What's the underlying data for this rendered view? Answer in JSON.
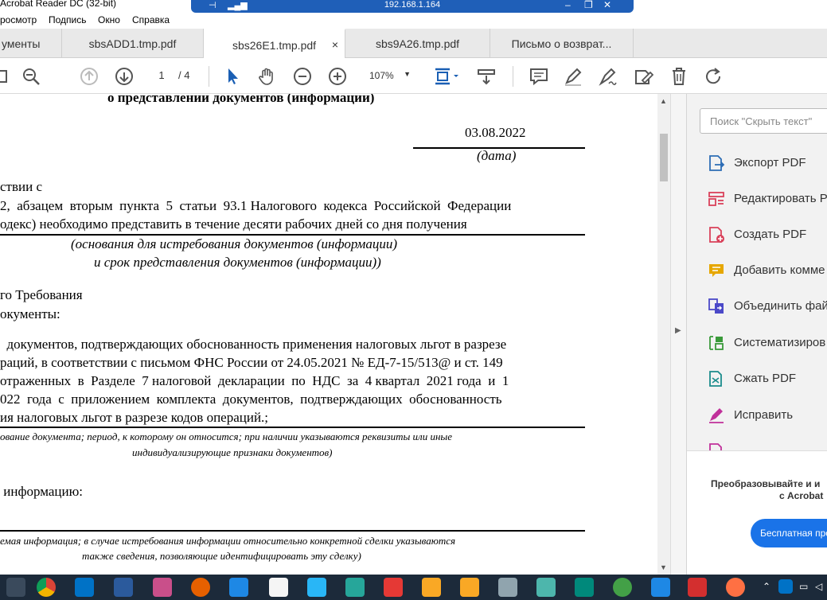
{
  "window": {
    "app_title": "Acrobat Reader DC (32-bit)",
    "rdp_ip": "192.168.1.164"
  },
  "menu": [
    "росмотр",
    "Подпись",
    "Окно",
    "Справка"
  ],
  "tabs": [
    {
      "label": "ументы"
    },
    {
      "label": "sbsADD1.tmp.pdf"
    },
    {
      "label": "sbs26E1.tmp.pdf",
      "close": "×"
    },
    {
      "label": "sbs9A26.tmp.pdf"
    },
    {
      "label": "Письмо о возврат..."
    }
  ],
  "toolbar": {
    "page_current": "1",
    "page_total": "/ 4",
    "zoom": "107%"
  },
  "document": {
    "heading": "о представлении документов (информации)",
    "date_value": "03.08.2022",
    "date_caption": "(дата)",
    "line1": "ствии с",
    "line2a": "2,  абзацем  вторым  пункта  5  статьи  93.1 Налогового  кодекса  Российской  Федерации",
    "line2b": "одекс) необходимо представить в течение десяти рабочих дней со дня получения",
    "basis_caption1": "(основания для истребования документов (информации)",
    "basis_caption2": "и срок представления документов (информации))",
    "line3": "го Требования",
    "line4": "окументы:",
    "p1": "  документов, подтверждающих обоснованность применения налоговых льгот в разрезе",
    "p2": "раций, в соответствии с письмом ФНС России от 24.05.2021 № ЕД-7-15/513@ и ст. 149",
    "p3": "отраженных  в  Разделе  7 налоговой  декларации  по  НДС  за  4 квартал  2021 года  и  1",
    "p4": "022  года  с  приложением  комплекта  документов,  подтверждающих  обоснованность",
    "p5": "ия налоговых льгот в разрезе кодов операций.;",
    "docs_caption1": "ование документа; период, к которому он относится; при наличии указываются реквизиты или иные",
    "docs_caption2": "индивидуализирующие признаки документов)",
    "line5": " информацию:",
    "info_caption1": "емая информация; в случае истребования информации относительно конкретной сделки указываются",
    "info_caption2": "также сведения, позволяющие идентифицировать эту сделку)"
  },
  "right_panel": {
    "search_placeholder": "Поиск \"Скрыть текст\"",
    "items": [
      {
        "label": "Экспорт PDF",
        "icon": "export-pdf-icon",
        "color": "#2d6db5"
      },
      {
        "label": "Редактировать P",
        "icon": "edit-pdf-icon",
        "color": "#d9415a"
      },
      {
        "label": "Создать PDF",
        "icon": "create-pdf-icon",
        "color": "#d9415a"
      },
      {
        "label": "Добавить комме",
        "icon": "comment-icon",
        "color": "#e6a700"
      },
      {
        "label": "Объединить фай",
        "icon": "combine-files-icon",
        "color": "#4b49c8"
      },
      {
        "label": "Систематизиров",
        "icon": "organize-pages-icon",
        "color": "#3a9a3a"
      },
      {
        "label": "Сжать PDF",
        "icon": "compress-pdf-icon",
        "color": "#1b8c8c"
      },
      {
        "label": "Исправить",
        "icon": "fill-sign-icon",
        "color": "#c0309a"
      }
    ],
    "promo_line1": "Преобразовывайте и и",
    "promo_line2": "с Acrobat",
    "trial_button": "Бесплатная про"
  }
}
